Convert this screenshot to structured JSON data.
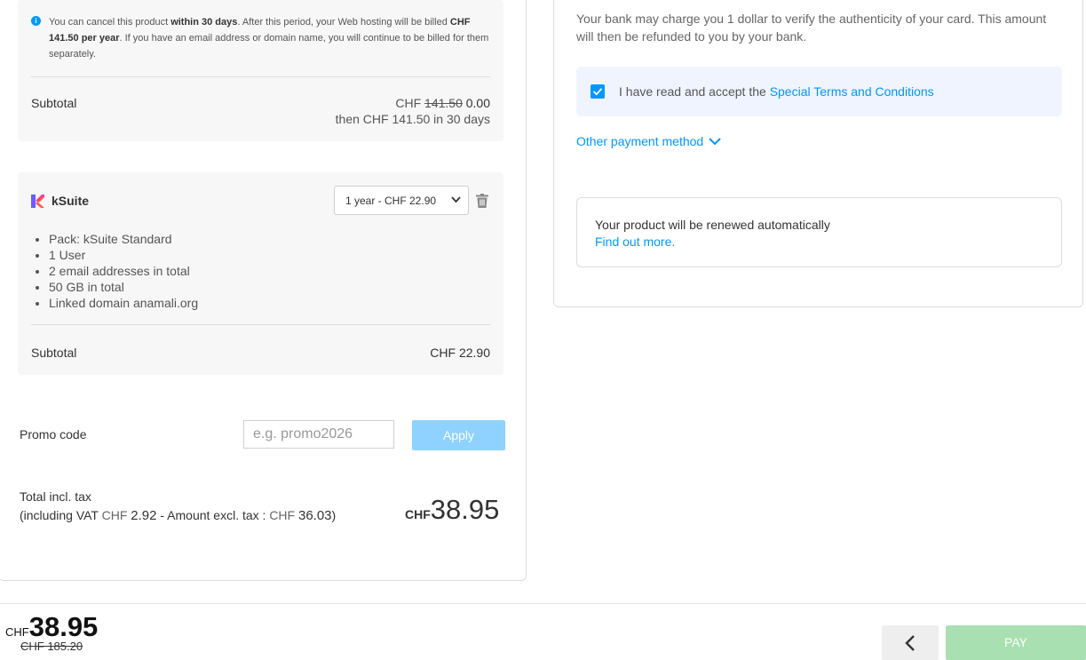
{
  "hosting": {
    "info_part1": "You can cancel this product ",
    "info_bold1": "within 30 days",
    "info_part2": ". After this period, your Web hosting will be billed ",
    "info_bold2": "CHF 141.50 per year",
    "info_part3": ". If you have an email address or domain name, you will continue to be billed for them separately.",
    "subtotal_label": "Subtotal",
    "subtotal_currency": "CHF",
    "subtotal_old": "141.50",
    "subtotal_new": "0.00",
    "subtotal_then": "then CHF 141.50 in 30 days"
  },
  "ksuite": {
    "title": "kSuite",
    "duration_select": "1 year - CHF 22.90",
    "features": [
      "Pack: kSuite Standard",
      "1 User",
      "2 email addresses in total",
      "50 GB in total",
      "Linked domain anamali.org"
    ],
    "subtotal_label": "Subtotal",
    "subtotal_value": "CHF 22.90"
  },
  "promo": {
    "label": "Promo code",
    "placeholder": "e.g. promo2026",
    "apply_label": "Apply"
  },
  "total": {
    "label": "Total incl. tax",
    "vat_prefix": "(including VAT ",
    "vat_currency": "CHF",
    "vat_value": "2.92",
    "excl_prefix": " - Amount excl. tax : ",
    "excl_currency": "CHF",
    "excl_value": "36.03",
    "suffix": ")",
    "currency": "CHF",
    "amount": "38.95"
  },
  "payment": {
    "bank_notice": "Your bank may charge you 1 dollar to verify the authenticity of your card. This amount will then be refunded to you by your bank.",
    "accept_text": "I have read and accept the ",
    "accept_link": "Special Terms and Conditions",
    "other_method": "Other payment method",
    "renew_title": "Your product will be renewed automatically",
    "renew_link": "Find out more."
  },
  "footer": {
    "currency": "CHF",
    "amount": "38.95",
    "old_price": "CHF 185.20",
    "pay_label": "PAY"
  },
  "colors": {
    "accent": "#0098ff",
    "apply_disabled": "#8fd2ff",
    "pay_disabled": "#a9e0b1"
  }
}
